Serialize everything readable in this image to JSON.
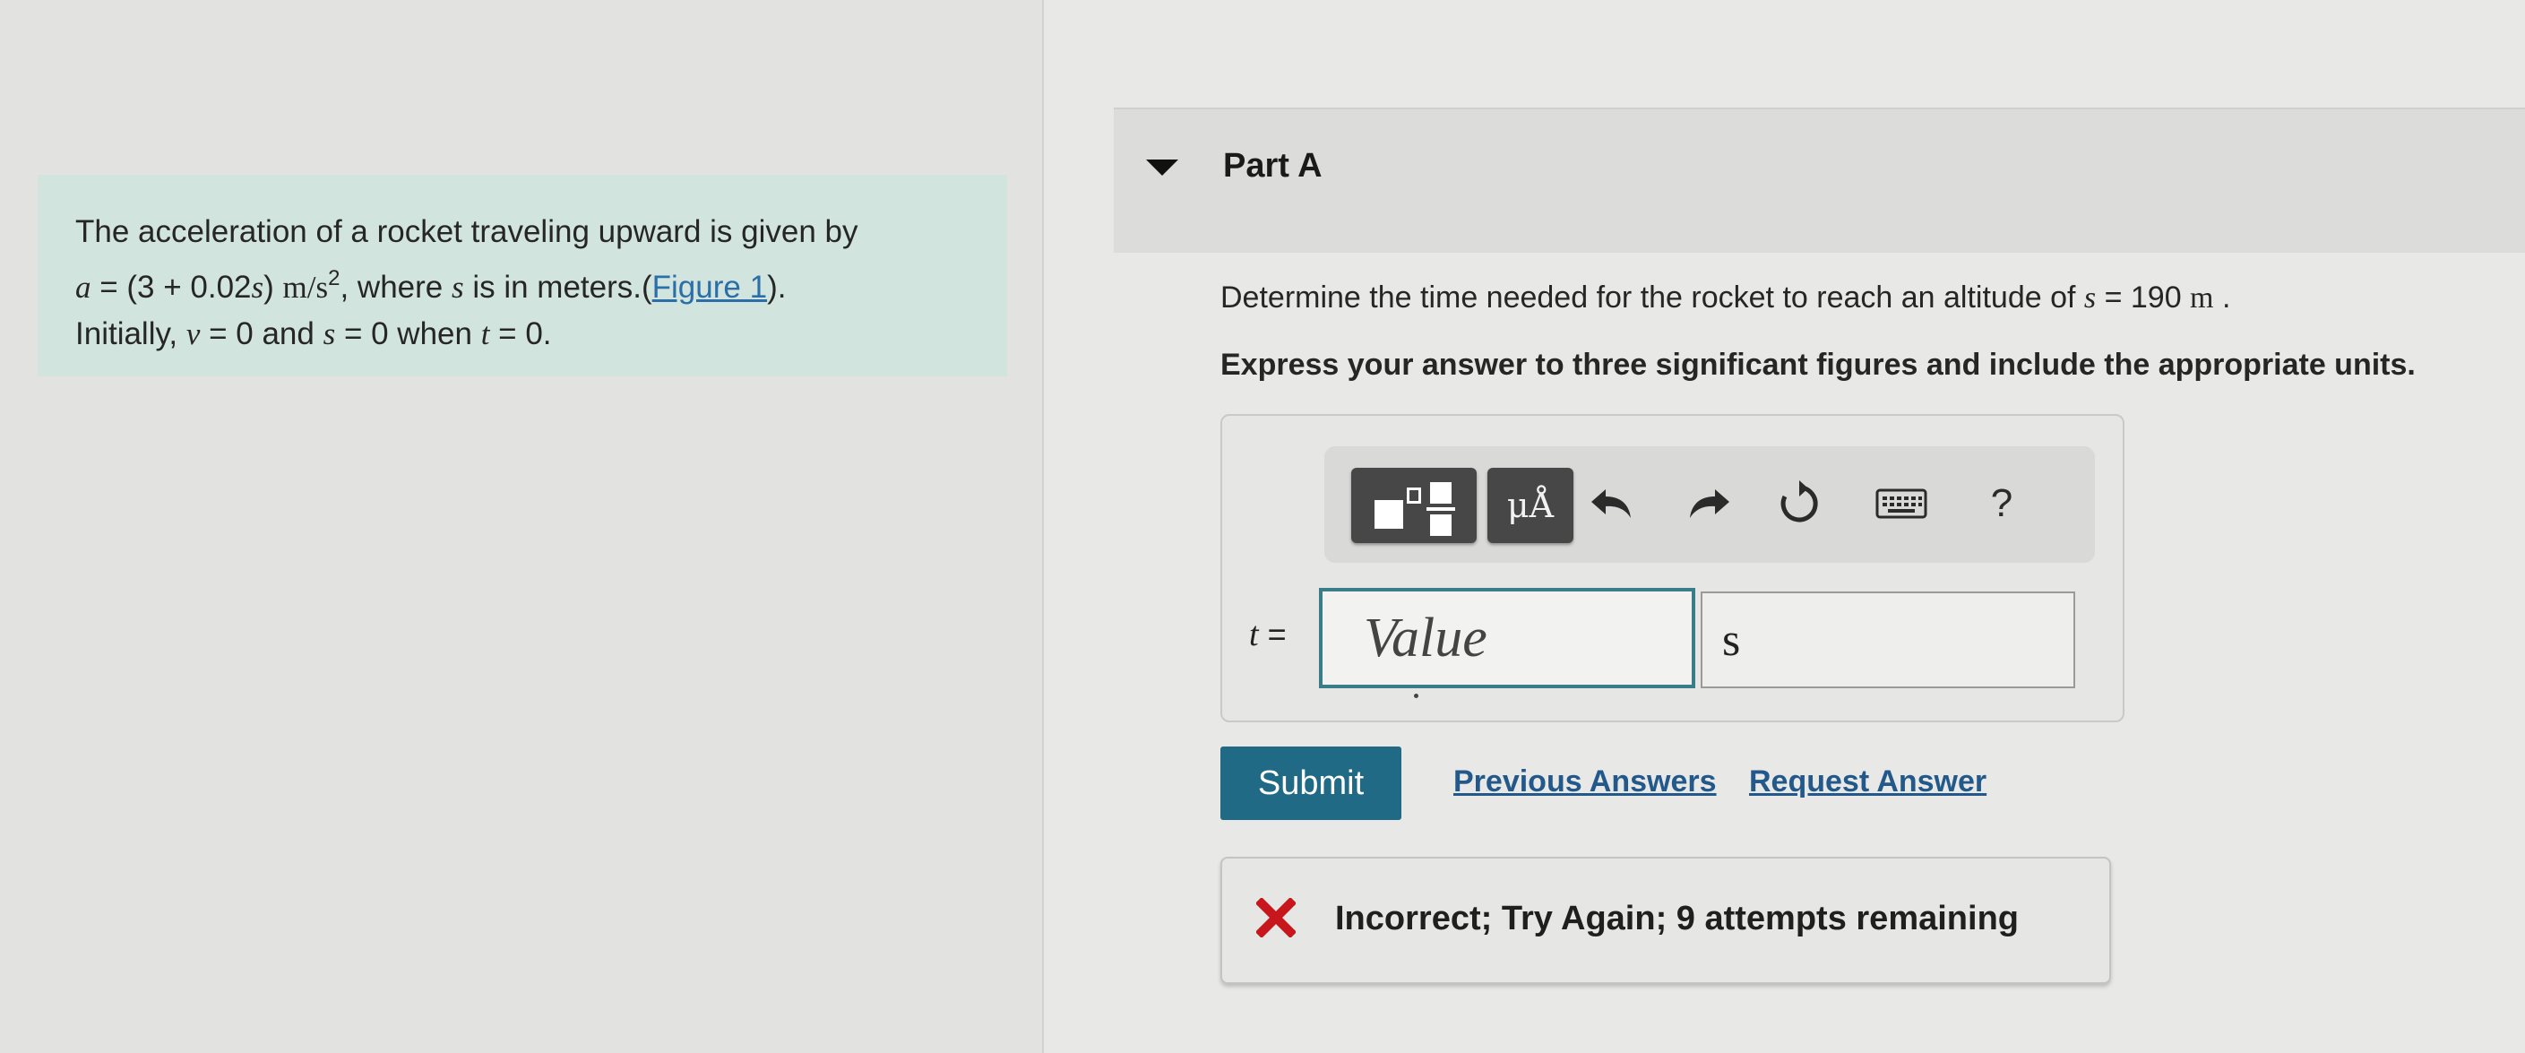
{
  "problem": {
    "line1": "The acceleration of a rocket traveling upward is given by",
    "formula_a": "a",
    "formula_eq": " = (3 + 0.02",
    "formula_s": "s",
    "formula_close": ") ",
    "formula_units": "m/s",
    "formula_units_exp": "2",
    "line2_tail_1": ", where ",
    "line2_s": "s",
    "line2_tail_2": " is in meters.(",
    "figure_link": "Figure 1",
    "line2_tail_3": ").",
    "line3_initially": "Initially, ",
    "line3_v": "v",
    "line3_mid1": " = 0 and ",
    "line3_s": "s",
    "line3_mid2": " = 0 when ",
    "line3_t": "t",
    "line3_end": " = 0."
  },
  "part": {
    "title": "Part A"
  },
  "question": {
    "text": "Determine the time needed for the rocket to reach an altitude of ",
    "var": "s",
    "value": " = 190 ",
    "unit": "m",
    "end": " ."
  },
  "instruction": "Express your answer to three significant figures and include the appropriate units.",
  "toolbar": {
    "units_label": "μÅ",
    "help_label": "?"
  },
  "answer": {
    "variable": "t",
    "equals": " =",
    "value_placeholder": "Value",
    "value": "",
    "units_value": "s"
  },
  "actions": {
    "submit_label": "Submit",
    "previous_answers_label": "Previous Answers",
    "request_answer_label": "Request Answer"
  },
  "feedback": {
    "text": "Incorrect; Try Again; 9 attempts remaining",
    "status_color": "#c8161d"
  },
  "colors": {
    "problem_bg": "#d2e4de",
    "submit_bg": "#206a86",
    "link": "#22598a",
    "input_focus_border": "#3a7c88"
  }
}
